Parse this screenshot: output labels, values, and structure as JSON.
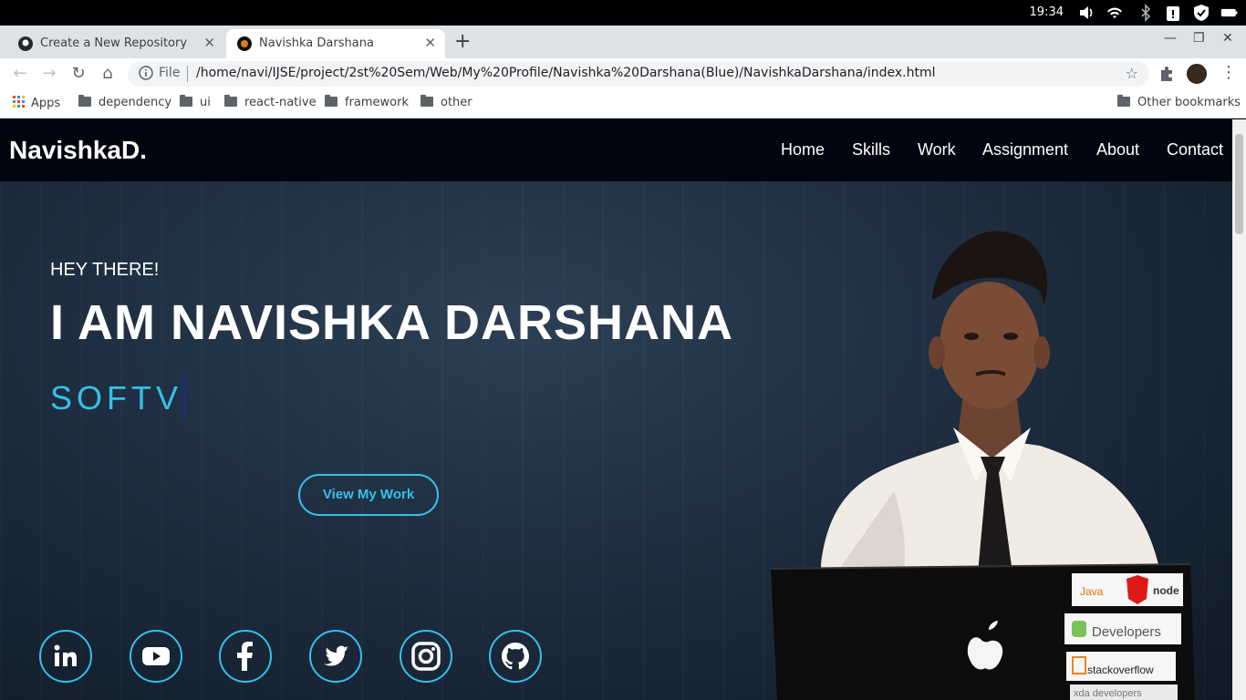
{
  "os": {
    "time": "19:34"
  },
  "tabs": [
    {
      "title": "Create a New Repository",
      "active": false,
      "icon": "github-icon"
    },
    {
      "title": "Navishka Darshana",
      "active": true,
      "icon": "site-favicon"
    }
  ],
  "address": {
    "scheme_label": "File",
    "url": "/home/navi/IJSE/project/2st%20Sem/Web/My%20Profile/Navishka%20Darshana(Blue)/NavishkaDarshana/index.html"
  },
  "bookmarks": {
    "apps_label": "Apps",
    "items": [
      "dependency",
      "ui",
      "react-native",
      "framework",
      "other"
    ],
    "other_label": "Other bookmarks"
  },
  "site": {
    "logo": "NavishkaD.",
    "nav": [
      "Home",
      "Skills",
      "Work",
      "Assignment",
      "About",
      "Contact"
    ],
    "greeting": "HEY THERE!",
    "headline": "I AM NAVISHKA DARSHANA",
    "typed_text": "SOFTV",
    "cta_label": "View My Work",
    "social": [
      "linkedin-icon",
      "youtube-icon",
      "facebook-icon",
      "twitter-icon",
      "instagram-icon",
      "github-icon"
    ],
    "laptop_stickers": [
      "Java",
      "node",
      "Developers",
      "stackoverflow",
      "xda developers"
    ]
  },
  "colors": {
    "accent": "#35c0ea",
    "nav_bg": "#02050f",
    "hero_bg": "#1b2a3b"
  }
}
